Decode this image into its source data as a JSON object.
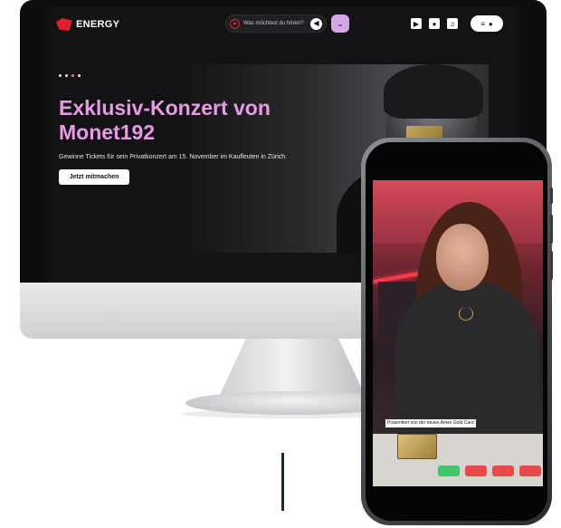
{
  "website": {
    "brand": "ENERGY",
    "search": {
      "placeholder": "Was möchtest du hören?"
    },
    "hero": {
      "title": "Exklusiv-Konzert von\nMonet192",
      "subtitle": "Gewinne Tickets für sein Privatkonzert am 15. November im Kaufleuten in Zürich.",
      "cta_label": "Jetzt mitmachen",
      "carousel": {
        "slides": 4,
        "active": 3
      }
    },
    "icons": {
      "play": "play-icon",
      "speaker": "speaker-icon",
      "dropdown": "chevron-down-icon",
      "video": "video-icon",
      "microphone": "microphone-icon",
      "playlist": "playlist-icon",
      "menu": "menu-icon",
      "user": "user-icon"
    },
    "colors": {
      "accent": "#e79ae6",
      "brand_red": "#e2202a",
      "background": "#131316"
    }
  },
  "phone": {
    "caption": "Präsentiert von der neuen Amex Gold Card"
  }
}
